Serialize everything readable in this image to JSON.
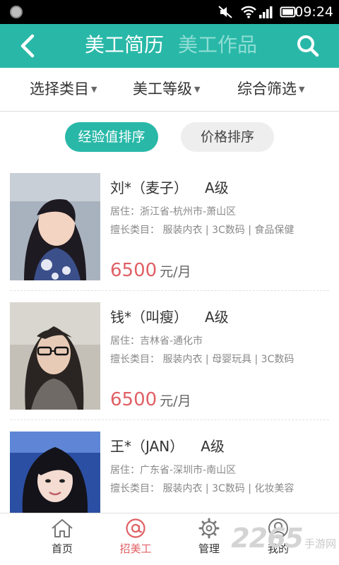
{
  "status_bar": {
    "time": "09:24",
    "icons": [
      "mute-icon",
      "wifi-icon",
      "signal-icon",
      "battery-icon"
    ]
  },
  "header": {
    "tabs": [
      {
        "label": "美工简历",
        "active": true
      },
      {
        "label": "美工作品",
        "active": false
      }
    ],
    "back_icon": "chevron-left-icon",
    "search_icon": "search-icon",
    "accent_color": "#29b8a8"
  },
  "filters": [
    {
      "label": "选择类目"
    },
    {
      "label": "美工等级"
    },
    {
      "label": "综合筛选"
    }
  ],
  "sort": {
    "options": [
      {
        "label": "经验值排序",
        "active": true
      },
      {
        "label": "价格排序",
        "active": false
      }
    ]
  },
  "list": [
    {
      "name": "刘*（麦子）",
      "grade": "A级",
      "location": "居住：浙江省-杭州市-萧山区",
      "skills": "擅长类目：  服装内衣 | 3C数码 | 食品保健",
      "price": "6500",
      "unit": "元/月"
    },
    {
      "name": "钱*（叫瘦）",
      "grade": "A级",
      "location": "居住：吉林省-通化市",
      "skills": "擅长类目：  服装内衣 | 母婴玩具 | 3C数码",
      "price": "6500",
      "unit": "元/月"
    },
    {
      "name": "王*（JAN）",
      "grade": "A级",
      "location": "居住：广东省-深圳市-南山区",
      "skills": "擅长类目：  服装内衣 | 3C数码 | 化妆美容",
      "price": "",
      "unit": ""
    }
  ],
  "bottom_nav": [
    {
      "label": "首页",
      "icon": "home-icon",
      "active": false
    },
    {
      "label": "招美工",
      "icon": "at-icon",
      "active": true
    },
    {
      "label": "管理",
      "icon": "gear-icon",
      "active": false
    },
    {
      "label": "我的",
      "icon": "user-icon",
      "active": false
    }
  ],
  "price_color": "#e06065",
  "watermark": {
    "big": "2265",
    "small": "手游网"
  }
}
